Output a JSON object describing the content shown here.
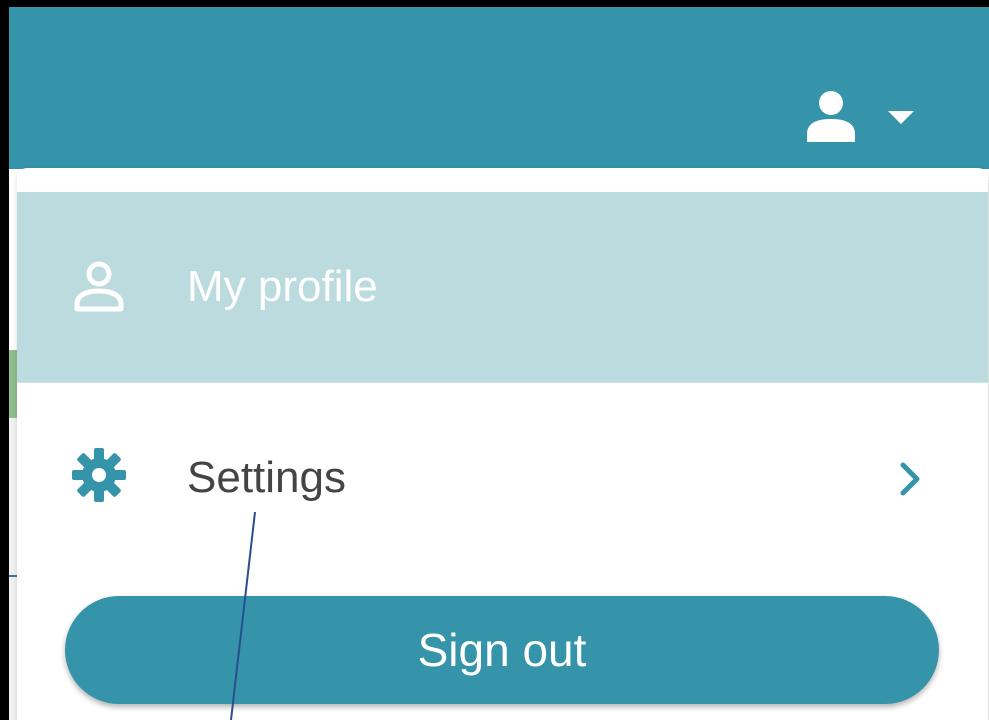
{
  "header": {
    "user_menu_icon": "user-icon",
    "dropdown_caret_icon": "caret-down-icon",
    "background_color": "#3594a9"
  },
  "menu": {
    "items": [
      {
        "label": "My profile",
        "icon": "user-outline-icon",
        "state": "hovered",
        "highlight_color": "#bcdbde"
      },
      {
        "label": "Settings",
        "icon": "gear-icon",
        "trailing_icon": "chevron-right-icon"
      }
    ],
    "sign_out_label": "Sign out"
  },
  "colors": {
    "accent": "#3594a9",
    "hover": "#bcdbde"
  }
}
